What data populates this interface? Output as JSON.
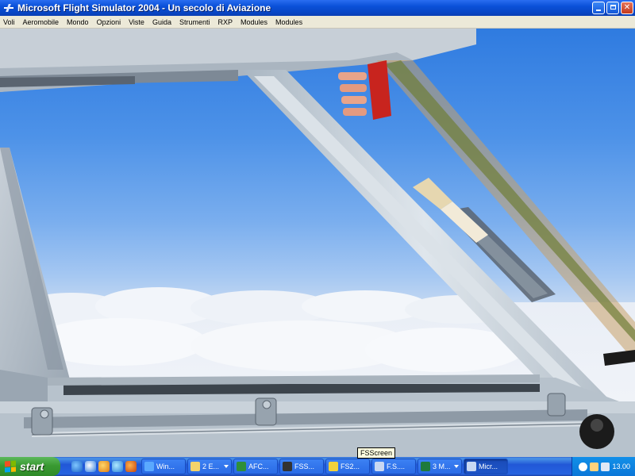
{
  "window": {
    "title": "Microsoft Flight Simulator 2004 - Un secolo di Aviazione"
  },
  "menu": [
    "Voli",
    "Aeromobile",
    "Mondo",
    "Opzioni",
    "Viste",
    "Guida",
    "Strumenti",
    "RXP",
    "Modules",
    "Modules"
  ],
  "tooltip": "FSScreen",
  "taskbar": {
    "start_label": "start",
    "quick_launch_icons": [
      "ie-icon",
      "outlook-icon",
      "media-player-icon",
      "messenger-icon",
      "firefox-icon"
    ],
    "tasks": [
      {
        "label": "Win...",
        "icon": "windows-icon",
        "color": "#5aa9ff",
        "active": false,
        "group": false
      },
      {
        "label": "2 E...",
        "icon": "folder-icon",
        "color": "#f3d36b",
        "active": false,
        "group": true
      },
      {
        "label": "AFC...",
        "icon": "afc-icon",
        "color": "#2f8f3a",
        "active": false,
        "group": false
      },
      {
        "label": "FSS...",
        "icon": "fsscreen-icon",
        "color": "#333333",
        "active": false,
        "group": false
      },
      {
        "label": "FS2...",
        "icon": "fs2-icon",
        "color": "#f2d23c",
        "active": false,
        "group": false
      },
      {
        "label": "F.S....",
        "icon": "plane-icon",
        "color": "#c9d8f2",
        "active": false,
        "group": false
      },
      {
        "label": "3 M...",
        "icon": "excel-icon",
        "color": "#1e7a3c",
        "active": false,
        "group": true
      },
      {
        "label": "Micr...",
        "icon": "flight-sim-icon",
        "color": "#c9d8f2",
        "active": true,
        "group": false
      }
    ],
    "clock": "13.00"
  },
  "colors": {
    "titlebar": "#0a50d8",
    "menubar": "#ece9d8",
    "taskbar": "#2157d7",
    "start": "#3a9a32",
    "tray": "#0b77d8"
  }
}
